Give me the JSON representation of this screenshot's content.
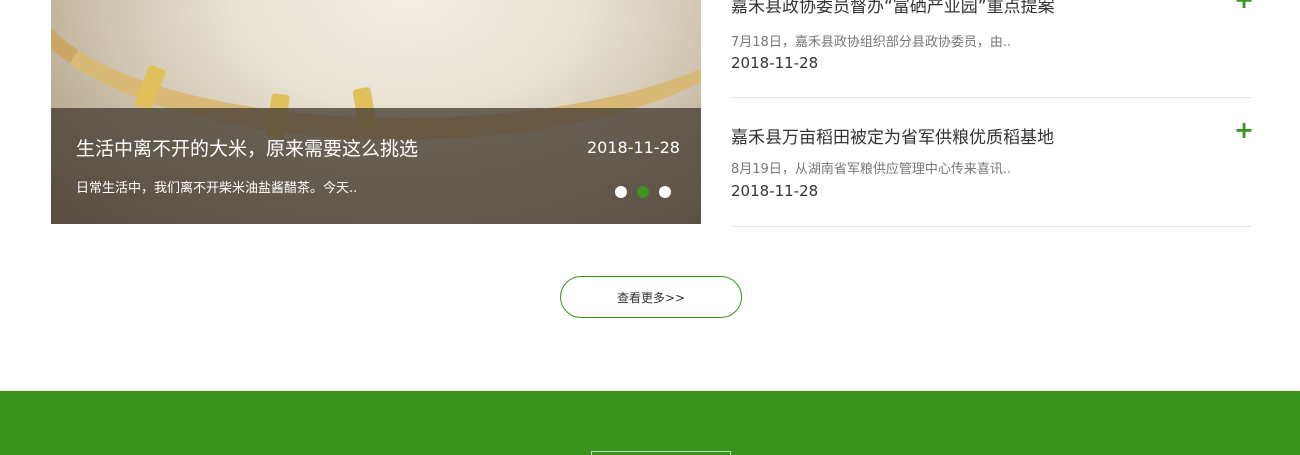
{
  "featured": {
    "title": "生活中离不开的大米，原来需要这么挑选",
    "date": "2018-11-28",
    "description": "日常生活中，我们离不开柴米油盐酱醋茶。今天..",
    "carousel": {
      "count": 3,
      "active_index": 1
    }
  },
  "news": [
    {
      "title": "嘉禾县政协委员督办“富硒产业园”重点提案",
      "summary": "7月18日，嘉禾县政协组织部分县政协委员，由..",
      "date": "2018-11-28",
      "icon": "plus-icon"
    },
    {
      "title": "嘉禾县万亩稻田被定为省军供粮优质稻基地",
      "summary": "8月19日，从湖南省军粮供应管理中心传来喜讯..",
      "date": "2018-11-28",
      "icon": "plus-icon"
    }
  ],
  "more_button": {
    "label": "查看更多>>"
  },
  "colors": {
    "accent": "#3a951f",
    "overlay": "#463e34",
    "text": "#333333",
    "muted": "#777777"
  }
}
